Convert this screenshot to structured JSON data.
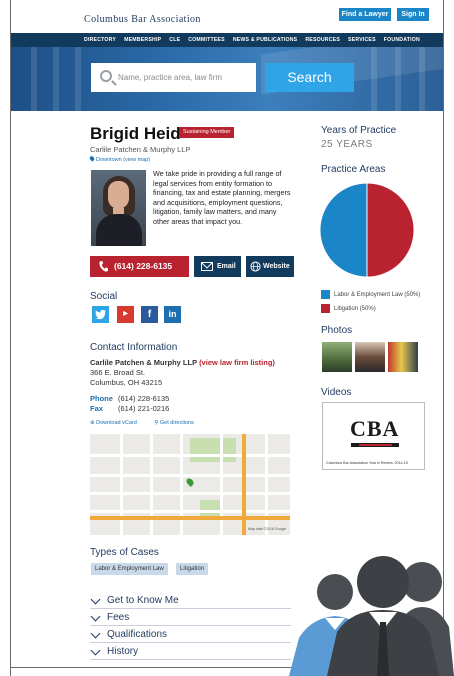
{
  "header": {
    "logo_text": "Columbus Bar Association",
    "find_lawyer_label": "Find a Lawyer",
    "sign_in_label": "Sign In"
  },
  "nav": {
    "items": [
      "DIRECTORY",
      "MEMBERSHIP",
      "CLE",
      "COMMITTEES",
      "NEWS & PUBLICATIONS",
      "RESOURCES",
      "SERVICES",
      "FOUNDATION"
    ]
  },
  "search": {
    "placeholder": "Name, practice area, law firm",
    "button_label": "Search"
  },
  "profile": {
    "name": "Brigid Heid",
    "badge": "Sustaining Member",
    "firm": "Carlile Patchen & Murphy LLP",
    "location_link": "Downtown (view map)",
    "bio": "We take pride in providing a full range of legal services from entity formation to financing, tax and estate planning, mergers and acquisitions, employment questions, litigation, family law matters, and many other areas that impact you.",
    "call_label": "(614) 228-6135",
    "email_label": "Email",
    "website_label": "Website"
  },
  "social": {
    "heading": "Social",
    "icons": [
      "twitter-icon",
      "youtube-icon",
      "facebook-icon",
      "linkedin-icon"
    ]
  },
  "contact": {
    "heading": "Contact Information",
    "firm": "Carlile Patchen & Murphy LLP",
    "firm_link": "(view law firm listing)",
    "street": "366 E. Broad St.",
    "city": "Columbus, OH 43215",
    "phone_label": "Phone",
    "phone": "(614) 228-6135",
    "fax_label": "Fax",
    "fax": "(614) 221-0216",
    "vcard_label": "Download vCard",
    "directions_label": "Get directions",
    "map_caption": "Map data ©2016 Google"
  },
  "types_of_cases": {
    "heading": "Types of Cases",
    "tags": [
      "Labor & Employment Law",
      "Litigation"
    ]
  },
  "accordion": {
    "items": [
      "Get to Know Me",
      "Fees",
      "Qualifications",
      "History"
    ]
  },
  "sidebar": {
    "years_heading": "Years of Practice",
    "years_value": "25 YEARS",
    "practice_heading": "Practice Areas",
    "photos_heading": "Photos",
    "videos_heading": "Videos",
    "video_caption": "Columbus Bar Association Year in Review, 2014-15",
    "video_logo": "CBA"
  },
  "chart_data": {
    "type": "pie",
    "categories": [
      "Labor & Employment Law (50%)",
      "Litigation (50%)"
    ],
    "values": [
      50,
      50
    ],
    "colors": [
      "#1a86c8",
      "#b8232f"
    ],
    "title": "",
    "legend": "bottom"
  },
  "colors": {
    "brand_navy": "#123a5c",
    "accent_blue": "#2fa4e7",
    "accent_red": "#b8232f"
  }
}
